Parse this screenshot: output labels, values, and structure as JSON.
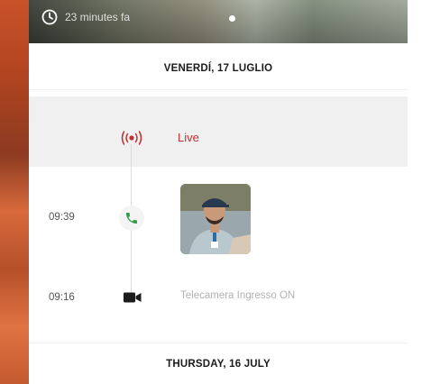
{
  "top_bar": {
    "time_ago": "23 minutes fa"
  },
  "days": [
    {
      "header": "VENERDÍ, 17 LUGLIO"
    },
    {
      "header": "THURSDAY, 16 JULY"
    }
  ],
  "live": {
    "label": "Live",
    "color": "#c22f2f"
  },
  "events": [
    {
      "time": "09:39",
      "icon": "phone-icon",
      "icon_color": "#2e9b45"
    },
    {
      "time": "09:16",
      "icon": "video-camera-icon",
      "label": "Telecamera Ingresso ON"
    }
  ]
}
